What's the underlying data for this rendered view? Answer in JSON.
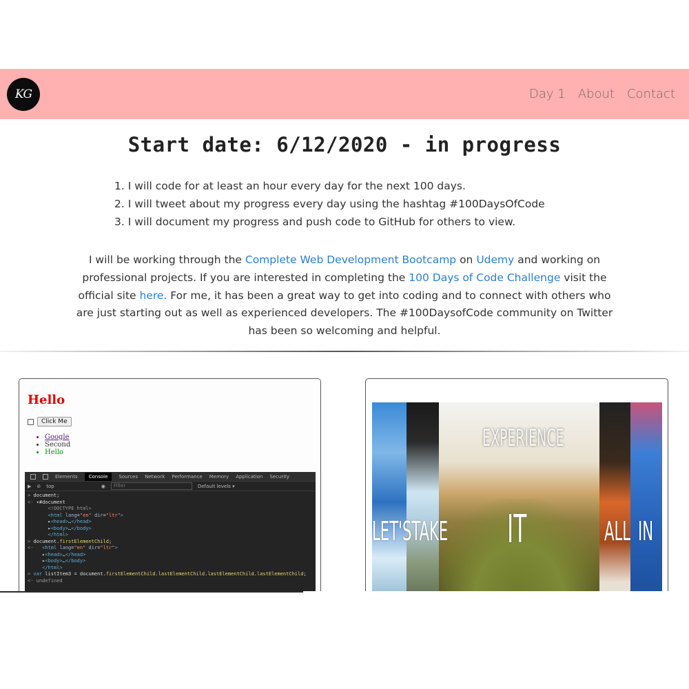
{
  "header": {
    "logo_text": "KG",
    "nav": [
      "Day 1",
      "About",
      "Contact"
    ]
  },
  "main": {
    "title": "Start date: 6/12/2020 - in progress",
    "goals": [
      "1. I will code for at least an hour every day for the next 100 days.",
      "2. I will tweet about my progress every day using the hashtag #100DaysOfCode",
      "3. I will document my progress and push code to GitHub for others to view."
    ],
    "intro": {
      "t1": "I will be working through the ",
      "link1": "Complete Web Development Bootcamp",
      "t2": " on ",
      "link2": "Udemy",
      "t3": " and working on professional projects. If you are interested in completing the ",
      "link3": "100 Days of Code Challenge",
      "t4": " visit the official site ",
      "link4": "here.",
      "t5": " For me, it has been a great way to get into coding and to connect with others who are just starting out as well as experienced developers. The #100DaysofCode community on Twitter has been so welcoming and helpful."
    }
  },
  "cards": {
    "left": {
      "hello": "Hello",
      "button": "Click Me",
      "list": [
        "Google",
        "Second",
        "Hello"
      ],
      "devtools": {
        "tabs": [
          "Elements",
          "Console",
          "Sources",
          "Network",
          "Performance",
          "Memory",
          "Application",
          "Security"
        ],
        "context": "top",
        "filter_placeholder": "Filter",
        "levels": "Default levels ▾"
      }
    },
    "right": {
      "words": [
        "EXPERIENCE",
        "LET'STAKE",
        "IT",
        "ALL",
        "IN"
      ]
    }
  },
  "colors": {
    "navbar": "#feb1b0",
    "link": "#2a7fd4",
    "hello_red": "#e00000"
  }
}
